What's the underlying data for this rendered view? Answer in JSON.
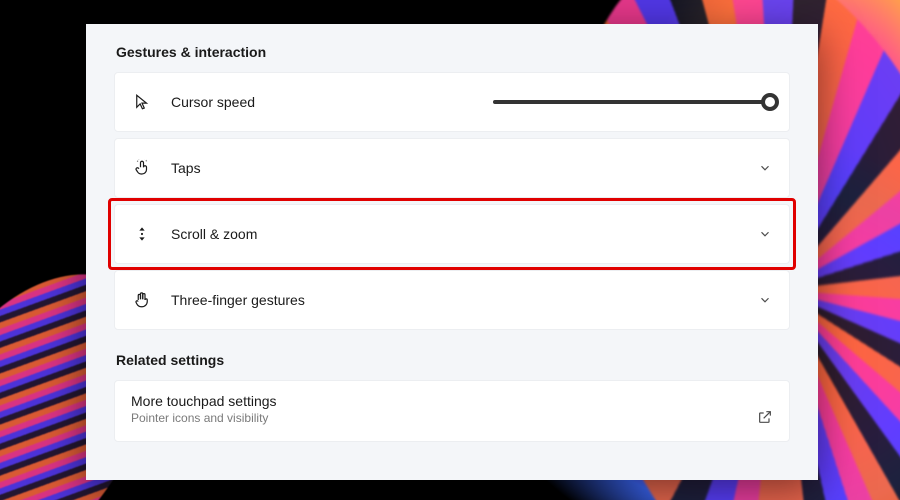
{
  "sections": {
    "gestures_title": "Gestures & interaction",
    "related_title": "Related settings"
  },
  "rows": {
    "cursor_speed": {
      "label": "Cursor speed",
      "slider_value_pct": 99
    },
    "taps": {
      "label": "Taps"
    },
    "scroll_zoom": {
      "label": "Scroll & zoom"
    },
    "three_finger": {
      "label": "Three-finger gestures"
    }
  },
  "related": {
    "more_touchpad": {
      "title": "More touchpad settings",
      "subtitle": "Pointer icons and visibility"
    }
  },
  "icons": {
    "cursor": "cursor-icon",
    "taps": "tap-icon",
    "scroll_zoom": "scroll-zoom-icon",
    "three_finger": "hand-icon",
    "chevron_down": "chevron-down-icon",
    "popout": "popout-icon"
  },
  "highlight_target": "scroll_zoom"
}
